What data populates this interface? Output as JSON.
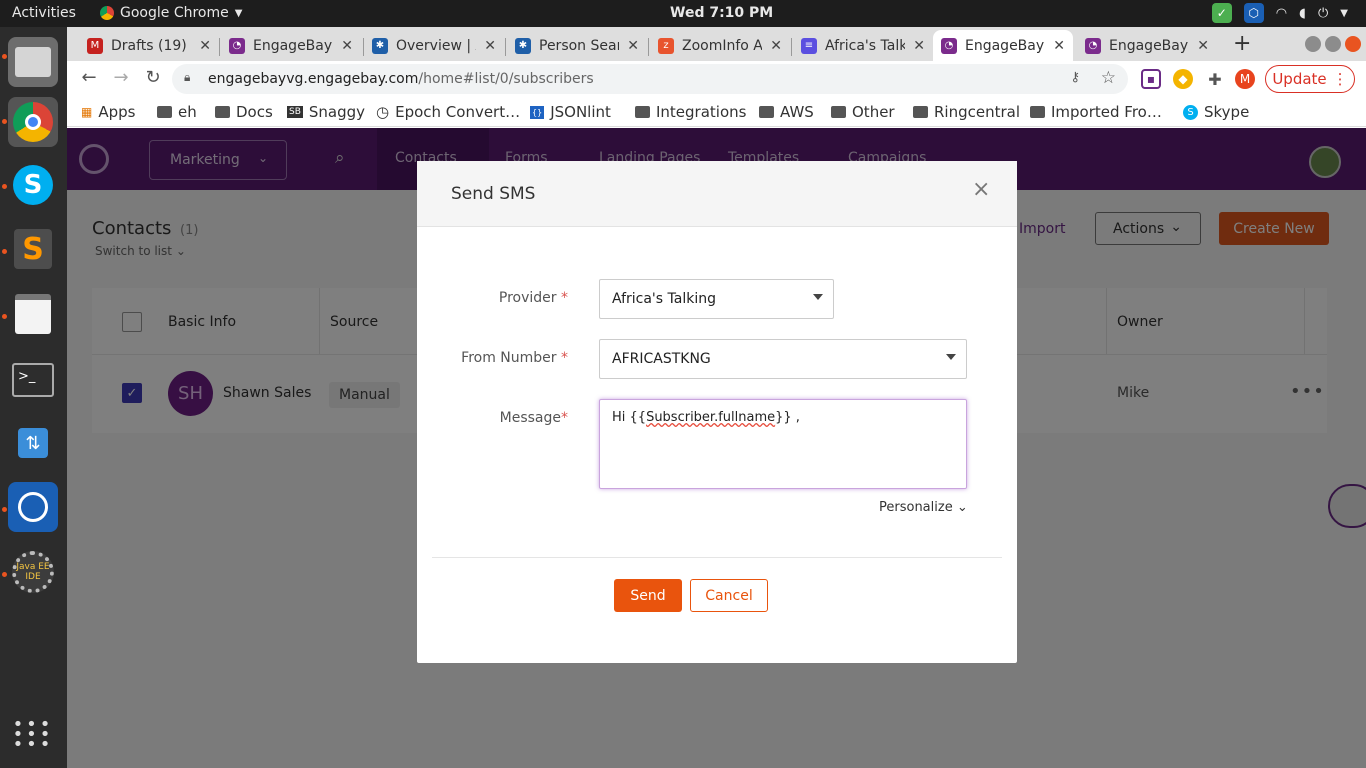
{
  "system": {
    "activities": "Activities",
    "app_name": "Google Chrome",
    "clock": "Wed  7:10 PM"
  },
  "tabs": [
    {
      "title": "Drafts (19) -",
      "favicon": "gmail-icon",
      "color": "#c5221f"
    },
    {
      "title": "EngageBay",
      "favicon": "engagebay-icon",
      "color": "#7b2b8c"
    },
    {
      "title": "Overview | Ar",
      "favicon": "snowflake-icon",
      "color": "#1f5fa8"
    },
    {
      "title": "Person Sear",
      "favicon": "snowflake-icon",
      "color": "#1f5fa8"
    },
    {
      "title": "ZoomInfo A",
      "favicon": "zoominfo-icon",
      "color": "#e8542e"
    },
    {
      "title": "Africa's Talk",
      "favicon": "forms-icon",
      "color": "#5b4fe0"
    },
    {
      "title": "EngageBay",
      "favicon": "engagebay-icon",
      "color": "#7b2b8c",
      "active": true
    },
    {
      "title": "EngageBay",
      "favicon": "engagebay-icon",
      "color": "#7b2b8c"
    }
  ],
  "url": {
    "host": "engagebayvg.engagebay.com",
    "path": "/home#list/0/subscribers"
  },
  "toolbar": {
    "update_label": "Update",
    "profile_letter": "M"
  },
  "bookmarks": [
    {
      "label": "Apps",
      "icon": "apps-grid-icon"
    },
    {
      "label": "eh",
      "icon": "folder-icon"
    },
    {
      "label": "Docs",
      "icon": "folder-icon"
    },
    {
      "label": "Snaggy",
      "icon": "snaggy-icon"
    },
    {
      "label": "Epoch Convert…",
      "icon": "epoch-icon"
    },
    {
      "label": "JSONlint",
      "icon": "jsonlint-icon"
    },
    {
      "label": "Integrations",
      "icon": "folder-icon"
    },
    {
      "label": "AWS",
      "icon": "folder-icon"
    },
    {
      "label": "Other",
      "icon": "folder-icon"
    },
    {
      "label": "Ringcentral",
      "icon": "folder-icon"
    },
    {
      "label": "Imported Fro…",
      "icon": "folder-icon"
    },
    {
      "label": "Skype",
      "icon": "skype-icon"
    }
  ],
  "appnav": {
    "marketing": "Marketing",
    "items": [
      "Contacts",
      "Forms",
      "Landing Pages",
      "Templates",
      "Campaigns"
    ]
  },
  "contacts": {
    "title": "Contacts",
    "count": "(1)",
    "switch_list": "Switch to list",
    "import": "Import",
    "actions": "Actions",
    "create_new": "Create New",
    "columns": {
      "basic_info": "Basic Info",
      "source": "Source",
      "owner": "Owner"
    },
    "row": {
      "initials": "SH",
      "name": "Shawn Sales",
      "source": "Manual",
      "owner": "Mike"
    }
  },
  "modal": {
    "title": "Send SMS",
    "provider_label": "Provider",
    "provider_value": "Africa's Talking",
    "from_label": "From Number",
    "from_value": "AFRICASTKNG",
    "message_label": "Message",
    "message_prefix": "Hi  {{",
    "message_var": "Subscriber.fullname",
    "message_suffix": "}} ,",
    "personalize": "Personalize",
    "send": "Send",
    "cancel": "Cancel"
  },
  "colors": {
    "brand_purple": "#5a1a73",
    "accent_orange": "#e9540d"
  }
}
